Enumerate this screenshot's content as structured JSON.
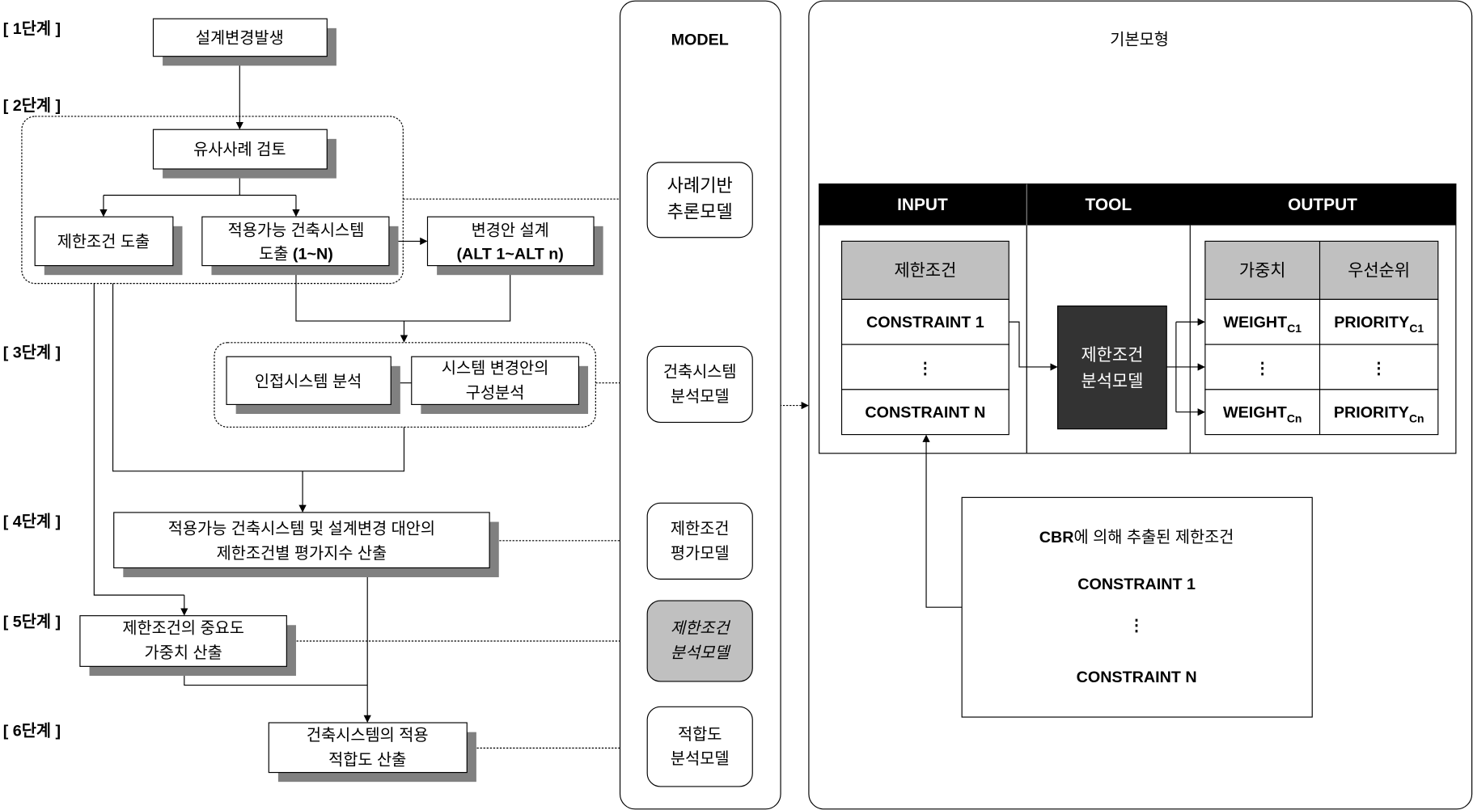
{
  "stages": [
    "[ 1단계 ]",
    "[ 2단계 ]",
    "[ 3단계 ]",
    "[ 4단계 ]",
    "[ 5단계 ]",
    "[ 6단계 ]"
  ],
  "process": {
    "design_change": "설계변경발생",
    "case_review": "유사사례 검토",
    "constraint_derive": "제한조건 도출",
    "system_derive": [
      "적용가능 건축시스템",
      "도출 ",
      "(1~N)"
    ],
    "alt_design": [
      "변경안 설계",
      "(ALT 1~ALT n)"
    ],
    "adjacent_analysis": "인접시스템 분석",
    "config_analysis": [
      "시스템 변경안의",
      "구성분석"
    ],
    "eval_index": [
      "적용가능 건축시스템 및 설계변경 대안의",
      "제한조건별 평가지수 산출"
    ],
    "weight_calc": [
      "제한조건의 중요도",
      "가중치 산출"
    ],
    "fitness_calc": [
      "건축시스템의 적용",
      "적합도 산출"
    ]
  },
  "model": {
    "title": "MODEL",
    "items": [
      [
        "사례기반",
        "추론모델"
      ],
      [
        "건축시스템",
        "분석모델"
      ],
      [
        "제한조건",
        "평가모델"
      ],
      [
        "제한조건",
        "분석모델"
      ],
      [
        "적합도",
        "분석모델"
      ]
    ],
    "highlighted_index": 3,
    "highlight_color": "#c0c0c0"
  },
  "basic": {
    "title": "기본모형",
    "headers": [
      "INPUT",
      "TOOL",
      "OUTPUT"
    ],
    "input_header": "제한조건",
    "input_rows": [
      "CONSTRAINT 1",
      "⋮",
      "CONSTRAINT N"
    ],
    "tool": [
      "제한조건",
      "분석모델"
    ],
    "output_headers": [
      "가중치",
      "우선순위"
    ],
    "output_rows": [
      {
        "w": "WEIGHT",
        "ws": "C1",
        "p": "PRIORITY",
        "ps": "C1"
      },
      {
        "w": "⋮",
        "p": "⋮"
      },
      {
        "w": "WEIGHT",
        "ws": "Cn",
        "p": "PRIORITY",
        "ps": "Cn"
      }
    ],
    "cbr": {
      "prefix": "CBR",
      "title": "에 의해 추출된 제한조건",
      "rows": [
        "CONSTRAINT 1",
        "⋮",
        "CONSTRAINT N"
      ]
    }
  }
}
